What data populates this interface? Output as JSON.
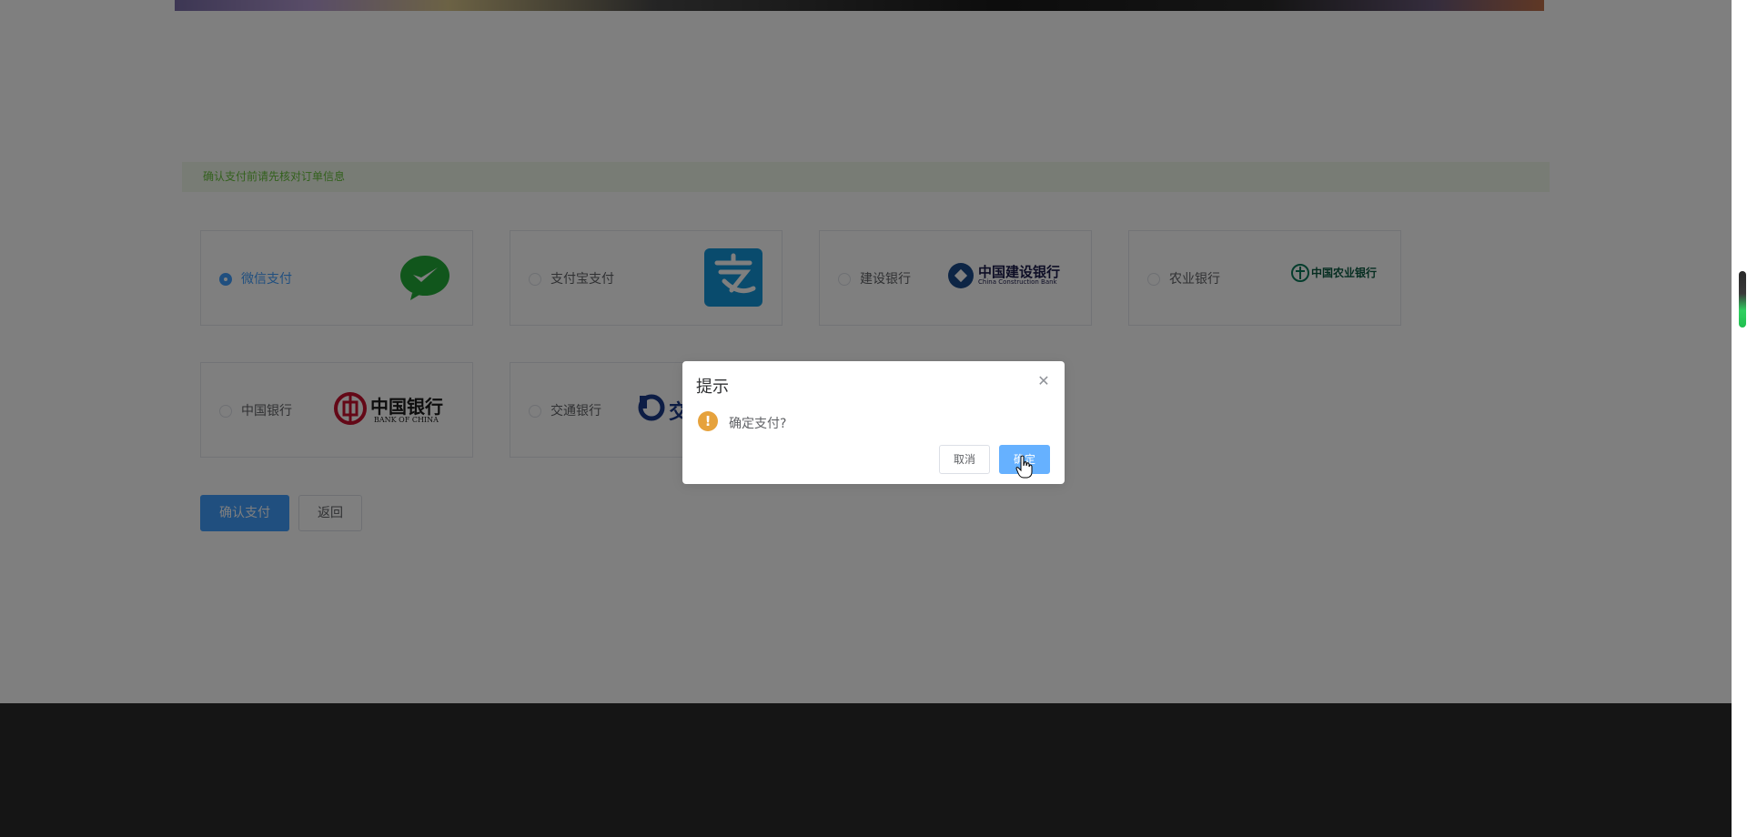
{
  "notice": {
    "text": "确认支付前请先核对订单信息"
  },
  "payment_methods": [
    {
      "label": "微信支付",
      "checked": true,
      "logo": "wechat-pay-logo"
    },
    {
      "label": "支付宝支付",
      "checked": false,
      "logo": "alipay-logo"
    },
    {
      "label": "建设银行",
      "checked": false,
      "logo": "ccb-logo",
      "logo_text": "中国建设银行",
      "logo_subtext": "China Construction Bank"
    },
    {
      "label": "农业银行",
      "checked": false,
      "logo": "abc-logo",
      "logo_text": "中国农业银行"
    },
    {
      "label": "中国银行",
      "checked": false,
      "logo": "boc-logo",
      "logo_text": "中国银行",
      "logo_subtext": "BANK OF CHINA"
    },
    {
      "label": "交通银行",
      "checked": false,
      "logo": "bocom-logo",
      "logo_text": "交"
    }
  ],
  "actions": {
    "confirm_label": "确认支付",
    "back_label": "返回"
  },
  "dialog": {
    "title": "提示",
    "message": "确定支付?",
    "cancel_label": "取消",
    "ok_label": "确定",
    "warn_glyph": "!",
    "close_glyph": "✕"
  },
  "colors": {
    "primary": "#409eff",
    "success_text": "#67c23a",
    "warning": "#e6a23c",
    "footer": "#2b2b2b"
  }
}
